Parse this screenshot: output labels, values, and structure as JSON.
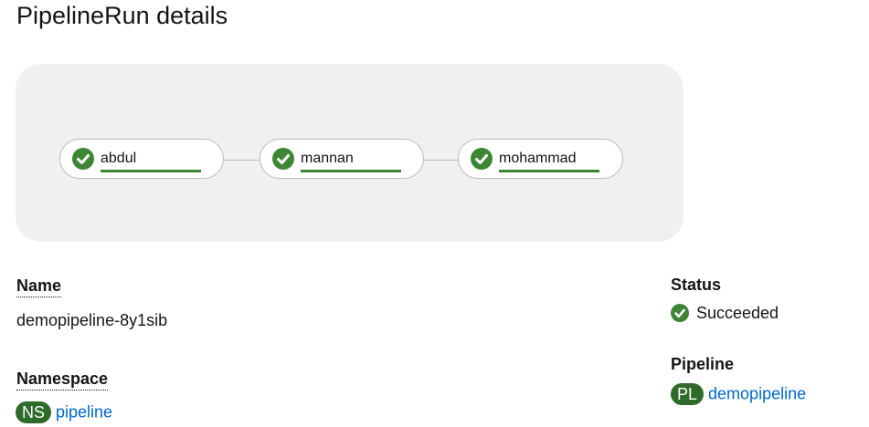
{
  "page": {
    "title": "PipelineRun details"
  },
  "graph": {
    "tasks": [
      {
        "name": "abdul",
        "status": "succeeded"
      },
      {
        "name": "mannan",
        "status": "succeeded"
      },
      {
        "name": "mohammad",
        "status": "succeeded"
      }
    ],
    "colors": {
      "success": "#3e8635",
      "background": "#f0f0f0"
    },
    "icons": {
      "task_status": "check-circle-icon"
    }
  },
  "details": {
    "name": {
      "label": "Name",
      "value": "demopipeline-8y1sib"
    },
    "namespace": {
      "label": "Namespace",
      "badge": "NS",
      "value": "pipeline"
    },
    "status": {
      "label": "Status",
      "value": "Succeeded",
      "icon": "check-circle-icon"
    },
    "pipeline": {
      "label": "Pipeline",
      "badge": "PL",
      "value": "demopipeline"
    }
  },
  "colors": {
    "link": "#0066cc",
    "badge": "#2e6a2a",
    "success": "#3e8635"
  }
}
